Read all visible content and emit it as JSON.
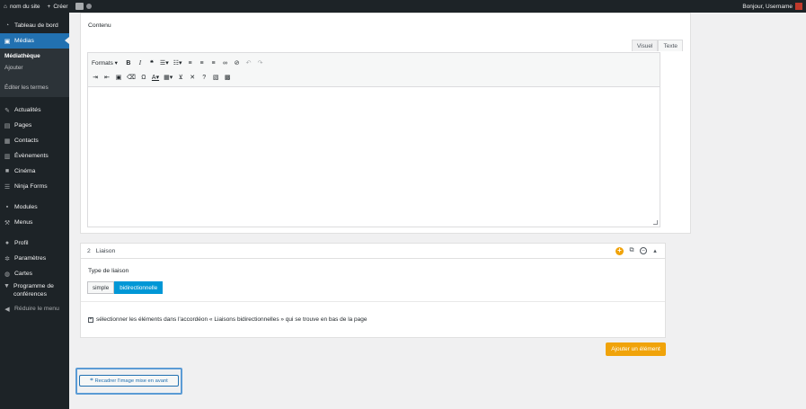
{
  "adminbar": {
    "site_name": "nom du site",
    "new_label": "Créer",
    "greeting": "Bonjour, Username"
  },
  "sidebar": {
    "items": [
      {
        "label": "Tableau de bord",
        "icon": "dashboard-icon"
      },
      {
        "label": "Médias",
        "icon": "media-icon",
        "current": true
      },
      {
        "label": "Actualités",
        "icon": "pin-icon"
      },
      {
        "label": "Pages",
        "icon": "page-icon"
      },
      {
        "label": "Contacts",
        "icon": "building-icon"
      },
      {
        "label": "Évènements",
        "icon": "calendar-icon"
      },
      {
        "label": "Cinéma",
        "icon": "video-icon"
      },
      {
        "label": "Ninja Forms",
        "icon": "form-icon"
      },
      {
        "label": "Modules",
        "icon": "grid-icon"
      },
      {
        "label": "Menus",
        "icon": "wrench-icon"
      },
      {
        "label": "Profil",
        "icon": "user-icon"
      },
      {
        "label": "Paramètres",
        "icon": "gear-icon"
      },
      {
        "label": "Cartes",
        "icon": "globe-icon"
      },
      {
        "label": "Programme de conférences",
        "icon": "speech-icon"
      },
      {
        "label": "Réduire le menu",
        "icon": "collapse-icon"
      }
    ],
    "submenu": {
      "library": "Médiathèque",
      "add": "Ajouter",
      "edit_terms": "Éditer les termes"
    }
  },
  "contenu": {
    "label": "Contenu",
    "tab_visual": "Visuel",
    "tab_text": "Texte",
    "format_label": "Formats"
  },
  "liaison": {
    "number": "2",
    "title": "Liaison",
    "type_label": "Type de liaison",
    "options": [
      "simple",
      "bidirectionnelle"
    ],
    "selected": "bidirectionnelle",
    "note": "sélectionner les éléments dans l'accordéon « Liaisons bidirectionnelles » qui se trouve en bas de la page"
  },
  "add_element_label": "Ajouter un élément",
  "regenerate_label": "Recadrer l'image mise en avant",
  "colors": {
    "admin_dark": "#1d2327",
    "accent_blue": "#2271b1",
    "toggle_blue": "#0097d6",
    "orange": "#f0a30a",
    "highlight": "#5b9bd5"
  }
}
